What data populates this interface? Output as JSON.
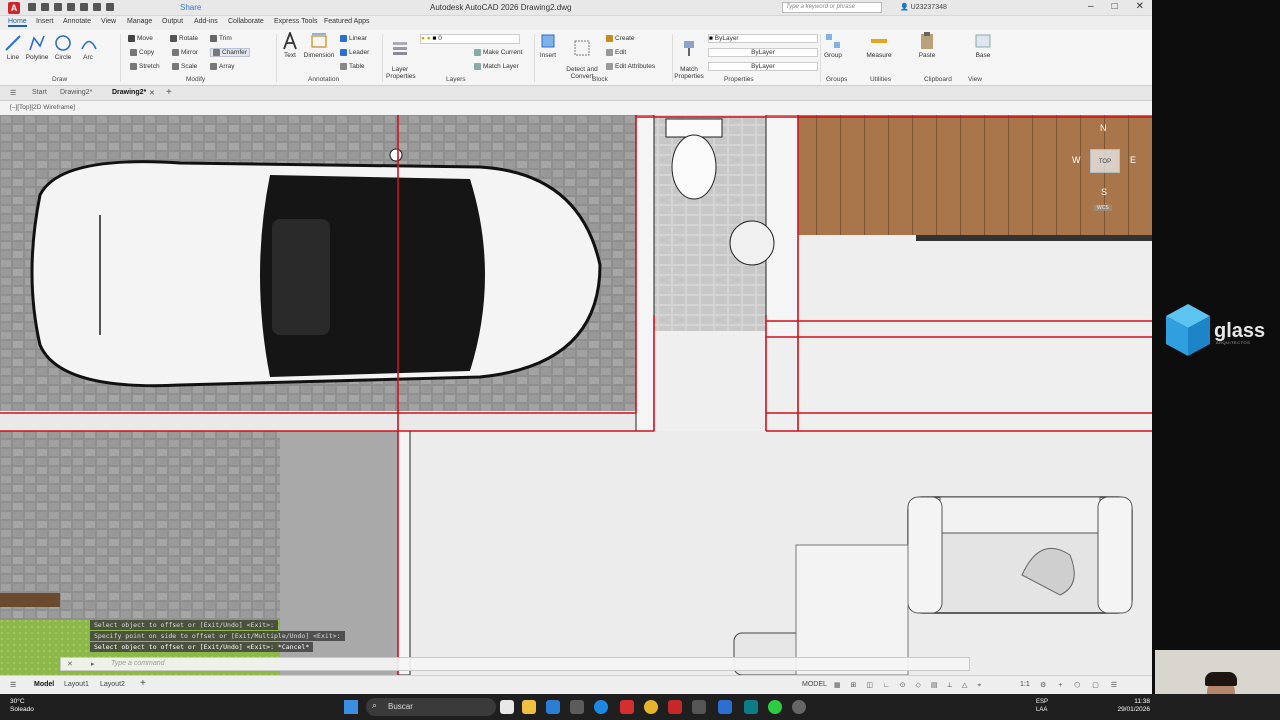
{
  "window": {
    "title": "Autodesk AutoCAD 2026   Drawing2.dwg",
    "search_placeholder": "Type a keyword or phrase",
    "user": "U23237348",
    "share": "Share",
    "minimize": "–",
    "maximize": "□",
    "close": "✕"
  },
  "ribbon_tabs": [
    "Home",
    "Insert",
    "Annotate",
    "View",
    "Manage",
    "Output",
    "Add-ins",
    "Collaborate",
    "Express Tools",
    "Featured Apps"
  ],
  "ribbon": {
    "draw": {
      "line": "Line",
      "polyline": "Polyline",
      "circle": "Circle",
      "arc": "Arc",
      "label": "Draw"
    },
    "modify": {
      "move": "Move",
      "rotate": "Rotate",
      "trim": "Trim",
      "copy": "Copy",
      "mirror": "Mirror",
      "chamfer": "Chamfer",
      "stretch": "Stretch",
      "scale": "Scale",
      "array": "Array",
      "label": "Modify"
    },
    "annotation": {
      "text": "Text",
      "dimension": "Dimension",
      "linear": "Linear",
      "leader": "Leader",
      "table": "Table",
      "label": "Annotation"
    },
    "layers": {
      "layer_properties": "Layer\nProperties",
      "layer_value": "0",
      "make_current": "Make Current",
      "match_layer": "Match Layer",
      "label": "Layers"
    },
    "block": {
      "insert": "Insert",
      "detect": "Detect and\nConvert",
      "create": "Create",
      "edit": "Edit",
      "edit_attributes": "Edit Attributes",
      "label": "Block"
    },
    "properties": {
      "match": "Match\nProperties",
      "bylayer1": "ByLayer",
      "bylayer2": "ByLayer",
      "bylayer3": "ByLayer",
      "label": "Properties"
    },
    "groups": {
      "group": "Group",
      "label": "Groups"
    },
    "utilities": {
      "measure": "Measure",
      "label": "Utilities"
    },
    "clipboard": {
      "paste": "Paste",
      "label": "Clipboard"
    },
    "view": {
      "base": "Base",
      "label": "View"
    }
  },
  "doc_tabs": {
    "start": "Start",
    "drawing2a": "Drawing2*",
    "drawing2b": "Drawing2*"
  },
  "viewport_label": "[–][Top][2D Wireframe]",
  "viewcube": {
    "n": "N",
    "s": "S",
    "e": "E",
    "w": "W",
    "top": "TOP",
    "wcs": "WCS"
  },
  "command_history": [
    "Select object to offset or [Exit/Undo] <Exit>:",
    "Specify point on side to offset or [Exit/Multiple/Undo] <Exit>:",
    "Select object to offset or [Exit/Undo] <Exit>: *Cancel*"
  ],
  "command_input": "Type a command",
  "layout_tabs": {
    "model": "Model",
    "layout1": "Layout1",
    "layout2": "Layout2"
  },
  "status": {
    "model": "MODEL",
    "scale": "1:1"
  },
  "taskbar": {
    "temp": "30°C",
    "weather": "Soleado",
    "search": "Buscar",
    "lang1": "ESP",
    "lang2": "LAA",
    "time": "11:38",
    "date": "29/01/2026"
  },
  "brand": {
    "name": "glass",
    "sub": "ARQUITECTOS"
  },
  "colors": {
    "accent": "#1b5fb4",
    "redline": "#d0101a",
    "brand": "#2f9fe0"
  }
}
